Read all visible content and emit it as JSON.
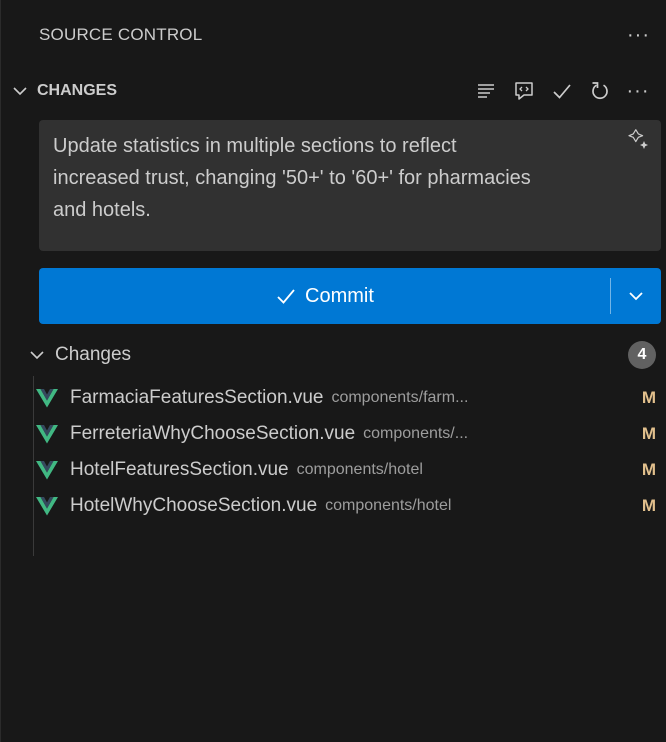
{
  "view": {
    "title": "SOURCE CONTROL",
    "more": "···"
  },
  "section": {
    "title": "CHANGES",
    "more": "···",
    "action_icons": [
      "list-icon",
      "comment-icon",
      "check-icon",
      "refresh-icon",
      "more-icon"
    ]
  },
  "message": {
    "text": "Update statistics in multiple sections to reflect increased trust, changing '50+' to '60+' for pharmacies and hotels.",
    "sparkle_icon": "sparkle-icon"
  },
  "commit": {
    "label": "Commit",
    "icon": "check-icon",
    "dropdown_icon": "chevron-down-icon"
  },
  "changes_group": {
    "title": "Changes",
    "count": "4"
  },
  "files": [
    {
      "name": "FarmaciaFeaturesSection.vue",
      "dir": "components/farm...",
      "status": "M"
    },
    {
      "name": "FerreteriaWhyChooseSection.vue",
      "dir": "components/...",
      "status": "M"
    },
    {
      "name": "HotelFeaturesSection.vue",
      "dir": "components/hotel",
      "status": "M"
    },
    {
      "name": "HotelWhyChooseSection.vue",
      "dir": "components/hotel",
      "status": "M"
    }
  ],
  "colors": {
    "background": "#181818",
    "input_background": "#313131",
    "accent": "#0078d4",
    "modified": "#e2c08d",
    "vue_green": "#41b883"
  }
}
